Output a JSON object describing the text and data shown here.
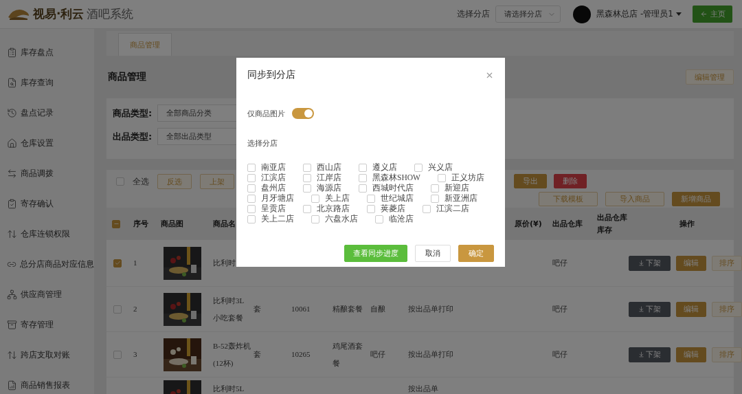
{
  "header": {
    "logo_brand": "视易·利云",
    "logo_product": "酒吧系统",
    "branch_label": "选择分店",
    "branch_select": {
      "placeholder": "请选择分店"
    },
    "user": "黑森林总店 -管理员1",
    "home_button": "主页"
  },
  "sidebar": {
    "items": [
      {
        "label": "库存盘点"
      },
      {
        "label": "库存查询"
      },
      {
        "label": "盘点记录"
      },
      {
        "label": "仓库设置"
      },
      {
        "label": "商品调拨"
      },
      {
        "label": "寄存确认"
      },
      {
        "label": "仓库连锁权限"
      },
      {
        "label": "总分店商品对应信息"
      },
      {
        "label": "供应商管理"
      },
      {
        "label": "寄存管理"
      },
      {
        "label": "跨店支取对账"
      },
      {
        "label": "商品销售报表"
      }
    ]
  },
  "tabs": [
    {
      "label": "商品管理",
      "selected": true
    }
  ],
  "page": {
    "title": "商品管理",
    "manage_button": "编辑管理"
  },
  "filters": [
    {
      "label": "商品类型:",
      "value": "全部商品分类"
    },
    {
      "label": "出品类型:",
      "value": "全部出品类型"
    }
  ],
  "toolbar": {
    "select_all": {
      "label": "全选",
      "checked": false
    },
    "left_buttons": [
      {
        "label": "反选",
        "kind": "outline"
      },
      {
        "label": "上架",
        "kind": "outline"
      }
    ],
    "right_buttons": [
      {
        "label": "导出",
        "kind": "primary"
      },
      {
        "label": "删除",
        "kind": "danger"
      }
    ],
    "second_row": [
      {
        "label": "下载模板",
        "kind": "outline"
      },
      {
        "label": "导入商品",
        "kind": "outline"
      },
      {
        "label": "新增商品",
        "kind": "primary"
      }
    ]
  },
  "table": {
    "header_checkbox": {
      "indeterminate": true
    },
    "columns": [
      {
        "kind": "seq",
        "label": "序号"
      },
      {
        "label": "商品图"
      },
      {
        "kind": "name",
        "label": "商品名"
      },
      {
        "kind": "original_price",
        "label": "原价(¥)"
      },
      {
        "kind": "warehouse",
        "label": "出品仓库"
      },
      {
        "kind": "stock",
        "label": "出品仓库库存"
      },
      {
        "kind": "actions",
        "label": "操作"
      }
    ],
    "rows": [
      {
        "checked": true,
        "cells": {
          "seq": "1",
          "name": "比利时",
          "warehouse": "吧仔"
        },
        "actions": [
          {
            "kind": "unlist",
            "label": "下架"
          },
          {
            "kind": "edit",
            "label": "编辑"
          },
          {
            "kind": "sort",
            "label": "排序"
          }
        ]
      },
      {
        "checked": false,
        "cells": {
          "seq": "2",
          "name": "比利时3L小吃套餐",
          "unit": "套",
          "code": "10061",
          "category": "精酿套餐",
          "print_type": "自酿",
          "print_mode": "按出品单打印",
          "warehouse": "吧仔"
        },
        "actions": [
          {
            "kind": "unlist",
            "label": "下架"
          },
          {
            "kind": "edit",
            "label": "编辑"
          },
          {
            "kind": "sort",
            "label": "排序"
          }
        ]
      },
      {
        "checked": false,
        "cells": {
          "seq": "3",
          "name": "B-52轰炸机(12杯)",
          "unit": "套",
          "code": "10265",
          "category": "鸡尾酒套餐",
          "print_type": "吧仔",
          "print_mode": "按出品单打印",
          "warehouse": "吧仔"
        },
        "actions": [
          {
            "kind": "unlist",
            "label": "下架"
          },
          {
            "kind": "edit",
            "label": "编辑"
          },
          {
            "kind": "sort",
            "label": "排序"
          }
        ]
      },
      {
        "cells": {
          "name": "比利时5L",
          "print_mode": "按出品单"
        }
      }
    ]
  },
  "modal": {
    "title": "同步到分店",
    "toggle": {
      "label": "仅商品图片",
      "on": true
    },
    "section_label": "选择分店",
    "stores": [
      {
        "label": "南亚店",
        "checked": false
      },
      {
        "label": "西山店",
        "checked": false
      },
      {
        "label": "遵义店",
        "checked": false
      },
      {
        "label": "兴义店",
        "checked": false
      },
      {
        "label": "江滨店",
        "checked": false
      },
      {
        "label": "江岸店",
        "checked": false
      },
      {
        "label": "黑森林SHOW",
        "checked": false
      },
      {
        "label": "正义坊店",
        "checked": false
      },
      {
        "label": "盘州店",
        "checked": false
      },
      {
        "label": "海源店",
        "checked": false
      },
      {
        "label": "西城时代店",
        "checked": false
      },
      {
        "label": "新迎店",
        "checked": false
      },
      {
        "label": "月牙塘店",
        "checked": false
      },
      {
        "label": "关上店",
        "checked": false
      },
      {
        "label": "世纪城店",
        "checked": false
      },
      {
        "label": "新亚洲店",
        "checked": false
      },
      {
        "label": "呈贡店",
        "checked": false
      },
      {
        "label": "北京路店",
        "checked": false
      },
      {
        "label": "荚菱店",
        "checked": false
      },
      {
        "label": "江滨二店",
        "checked": false
      },
      {
        "label": "关上二店",
        "checked": false
      },
      {
        "label": "六盘水店",
        "checked": false
      },
      {
        "label": "临沧店",
        "checked": false
      }
    ],
    "buttons": [
      {
        "label": "查看同步进度",
        "kind": "success"
      },
      {
        "label": "取消",
        "kind": "outline"
      },
      {
        "label": "确定",
        "kind": "primary"
      }
    ]
  }
}
